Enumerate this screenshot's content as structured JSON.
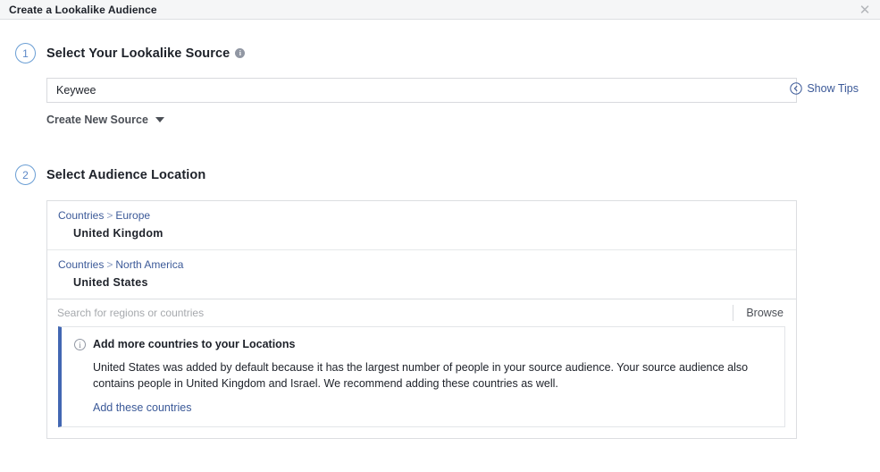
{
  "window": {
    "title": "Create a Lookalike Audience",
    "close_icon": "close-icon",
    "close_glyph": "✕"
  },
  "tips": {
    "label": "Show Tips",
    "icon": "circled-chevron-left-icon"
  },
  "steps": [
    {
      "number": "1",
      "title": "Select Your Lookalike Source",
      "has_info_icon": true,
      "info_glyph": "i"
    },
    {
      "number": "2",
      "title": "Select Audience Location",
      "has_info_icon": false,
      "info_glyph": ""
    }
  ],
  "source": {
    "value": "Keywee",
    "placeholder": "",
    "create_new_label": "Create New Source",
    "caret_icon": "chevron-down-icon"
  },
  "locations": {
    "groups": [
      {
        "breadcrumb_root": "Countries",
        "breadcrumb_sep": ">",
        "breadcrumb_region": "Europe",
        "name": "United Kingdom"
      },
      {
        "breadcrumb_root": "Countries",
        "breadcrumb_sep": ">",
        "breadcrumb_region": "North America",
        "name": "United States"
      }
    ],
    "search_placeholder": "Search for regions or countries",
    "browse_label": "Browse"
  },
  "notice": {
    "icon": "info-circle-icon",
    "icon_glyph": "i",
    "title": "Add more countries to your Locations",
    "body": "United States was added by default because it has the largest number of people in your source audience. Your source audience also contains people in United Kingdom and Israel. We recommend adding these countries as well.",
    "link_label": "Add these countries"
  },
  "colors": {
    "link_blue": "#3b5998",
    "accent_blue": "#4267b2",
    "badge_blue": "#5b87c7",
    "header_bg": "#f5f6f7",
    "text": "#1d2129"
  }
}
